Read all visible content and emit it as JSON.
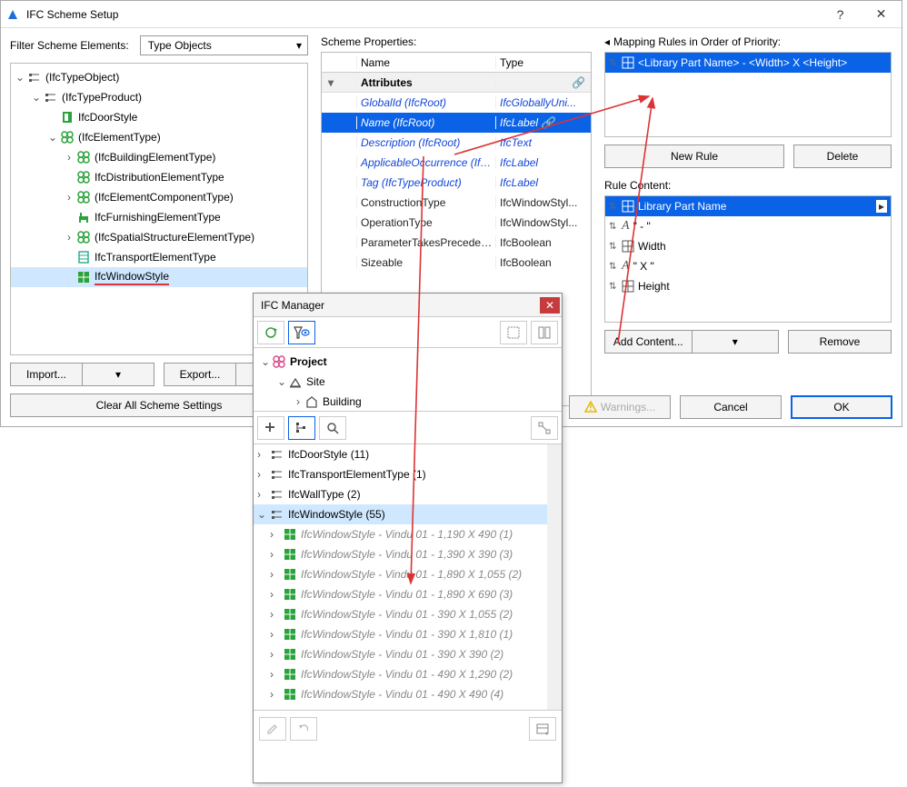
{
  "window": {
    "title": "IFC Scheme Setup"
  },
  "filter": {
    "label": "Filter Scheme Elements:",
    "value": "Type Objects"
  },
  "tree": [
    {
      "level": 0,
      "caret": "v",
      "icon": "type",
      "label": "(IfcTypeObject)"
    },
    {
      "level": 1,
      "caret": "v",
      "icon": "type",
      "label": "(IfcTypeProduct)"
    },
    {
      "level": 2,
      "caret": "",
      "icon": "door-g",
      "label": "IfcDoorStyle"
    },
    {
      "level": 2,
      "caret": "v",
      "icon": "elem-g",
      "label": "(IfcElementType)"
    },
    {
      "level": 3,
      "caret": ">",
      "icon": "elem-g",
      "label": "(IfcBuildingElementType)"
    },
    {
      "level": 3,
      "caret": "",
      "icon": "elem-g",
      "label": "IfcDistributionElementType"
    },
    {
      "level": 3,
      "caret": ">",
      "icon": "elem-g",
      "label": "(IfcElementComponentType)"
    },
    {
      "level": 3,
      "caret": "",
      "icon": "furn-g",
      "label": "IfcFurnishingElementType"
    },
    {
      "level": 3,
      "caret": ">",
      "icon": "elem-g",
      "label": "(IfcSpatialStructureElementType)"
    },
    {
      "level": 3,
      "caret": "",
      "icon": "trans",
      "label": "IfcTransportElementType"
    },
    {
      "level": 3,
      "caret": "",
      "icon": "win-g",
      "label": "IfcWindowStyle",
      "selected": true,
      "underline": true
    }
  ],
  "buttons": {
    "import": "Import...",
    "export": "Export...",
    "clear": "Clear All Scheme Settings",
    "newRule": "New Rule",
    "delete": "Delete",
    "addContent": "Add Content...",
    "remove": "Remove",
    "warnings": "Warnings...",
    "cancel": "Cancel",
    "ok": "OK"
  },
  "schemeProps": {
    "label": "Scheme Properties:",
    "headName": "Name",
    "headType": "Type",
    "group": "Attributes",
    "rows": [
      {
        "name": "GlobalId (IfcRoot)",
        "type": "IfcGloballyUni...",
        "link": true
      },
      {
        "name": "Name (IfcRoot)",
        "type": "IfcLabel",
        "link": true,
        "selected": true,
        "chain": true
      },
      {
        "name": "Description (IfcRoot)",
        "type": "IfcText",
        "link": true
      },
      {
        "name": "ApplicableOccurrence (IfcType...",
        "type": "IfcLabel",
        "link": true
      },
      {
        "name": "Tag (IfcTypeProduct)",
        "type": "IfcLabel",
        "link": true
      },
      {
        "name": "ConstructionType",
        "type": "IfcWindowStyl...",
        "link": false
      },
      {
        "name": "OperationType",
        "type": "IfcWindowStyl...",
        "link": false
      },
      {
        "name": "ParameterTakesPrecedence",
        "type": "IfcBoolean",
        "link": false
      },
      {
        "name": "Sizeable",
        "type": "IfcBoolean",
        "link": false
      }
    ]
  },
  "mapping": {
    "label": "Mapping Rules in Order of Priority:",
    "rows": [
      {
        "text": "<Library Part Name> - <Width> X <Height>",
        "icon": "grid",
        "selected": true
      }
    ]
  },
  "ruleContent": {
    "label": "Rule Content:",
    "rows": [
      {
        "icon": "grid",
        "text": "Library Part Name",
        "selected": true,
        "menu": true
      },
      {
        "icon": "txt",
        "text": "\" - \""
      },
      {
        "icon": "grid",
        "text": "Width"
      },
      {
        "icon": "txt",
        "text": "\" X \""
      },
      {
        "icon": "grid",
        "text": "Height"
      }
    ]
  },
  "ifcMgr": {
    "title": "IFC Manager",
    "project": [
      {
        "level": 0,
        "caret": "v",
        "icon": "proj",
        "label": "Project",
        "bold": true
      },
      {
        "level": 1,
        "caret": "v",
        "icon": "site",
        "label": "Site"
      },
      {
        "level": 2,
        "caret": ">",
        "icon": "bldg",
        "label": "Building"
      }
    ],
    "categories": [
      {
        "caret": ">",
        "icon": "type",
        "label": "IfcDoorStyle (11)"
      },
      {
        "caret": ">",
        "icon": "type",
        "label": "IfcTransportElementType (1)"
      },
      {
        "caret": ">",
        "icon": "type",
        "label": "IfcWallType (2)"
      },
      {
        "caret": "v",
        "icon": "type",
        "label": "IfcWindowStyle (55)",
        "selected": true
      }
    ],
    "children": [
      "IfcWindowStyle - Vindu 01 - 1,190 X 490 (1)",
      "IfcWindowStyle - Vindu 01 - 1,390 X 390 (3)",
      "IfcWindowStyle - Vindu 01 - 1,890 X 1,055 (2)",
      "IfcWindowStyle - Vindu 01 - 1,890 X 690 (3)",
      "IfcWindowStyle - Vindu 01 - 390 X 1,055 (2)",
      "IfcWindowStyle - Vindu 01 - 390 X 1,810 (1)",
      "IfcWindowStyle - Vindu 01 - 390 X 390 (2)",
      "IfcWindowStyle - Vindu 01 - 490 X 1,290 (2)",
      "IfcWindowStyle - Vindu 01 - 490 X 490 (4)"
    ]
  }
}
